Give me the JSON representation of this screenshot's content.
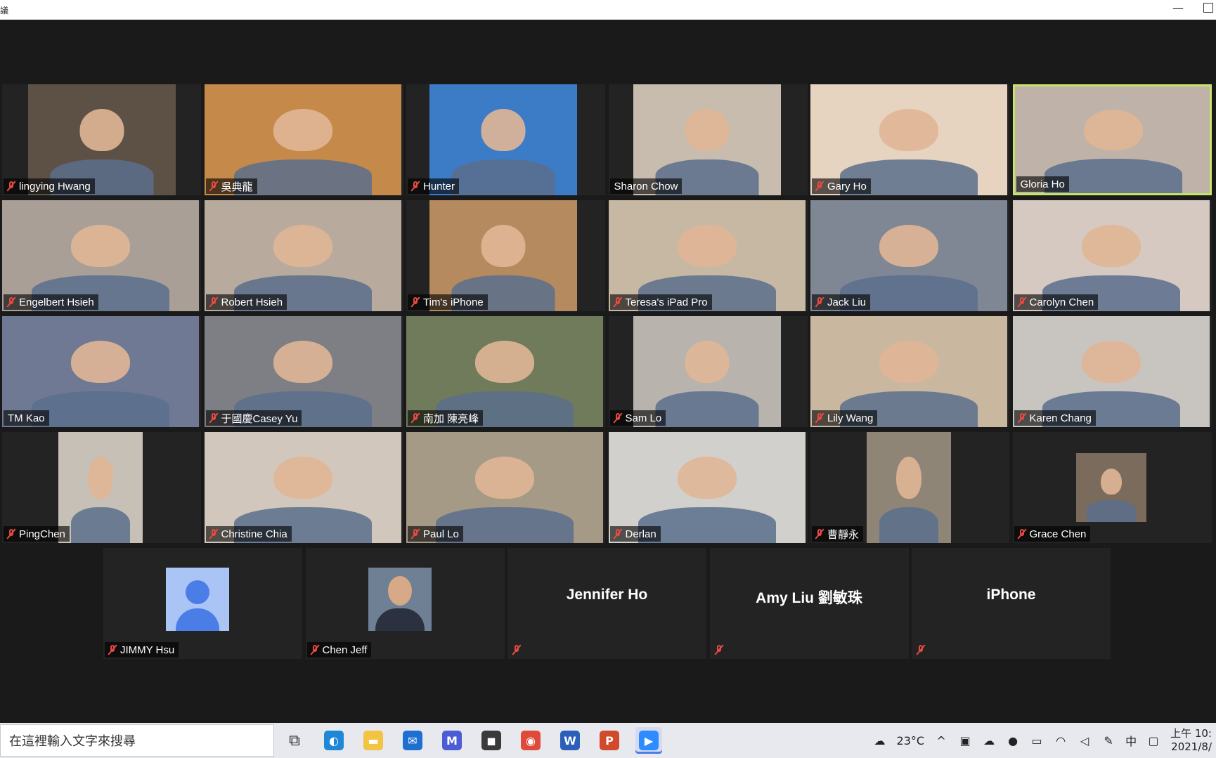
{
  "window": {
    "title_glyph": "議",
    "minimize": "—"
  },
  "tiles": [
    {
      "name": "lingying Hwang",
      "muted": true,
      "col": 0,
      "row": 0,
      "bg": "#5d5146",
      "vx": 37,
      "vw": 210
    },
    {
      "name": "吳典龍",
      "muted": true,
      "col": 1,
      "row": 0,
      "bg": "#c58a4a",
      "vx": 0,
      "vw": 280
    },
    {
      "name": "Hunter",
      "muted": true,
      "col": 2,
      "row": 0,
      "bg": "#3c7cc7",
      "vx": 33,
      "vw": 210
    },
    {
      "name": "Sharon Chow",
      "muted": false,
      "col": 3,
      "row": 0,
      "bg": "#c7bcae",
      "vx": 35,
      "vw": 210
    },
    {
      "name": "Gary Ho",
      "muted": true,
      "col": 4,
      "row": 0,
      "bg": "#e6d3c0",
      "vx": 0,
      "vw": 280
    },
    {
      "name": "Gloria Ho",
      "muted": false,
      "col": 5,
      "row": 0,
      "bg": "#bfb2a8",
      "vx": 0,
      "vw": 280,
      "active": true
    },
    {
      "name": "Engelbert Hsieh",
      "muted": true,
      "col": 0,
      "row": 1,
      "bg": "#a99f97",
      "vx": 0,
      "vw": 280
    },
    {
      "name": "Robert Hsieh",
      "muted": true,
      "col": 1,
      "row": 1,
      "bg": "#b8aa9d",
      "vx": 0,
      "vw": 280
    },
    {
      "name": "Tim's iPhone",
      "muted": true,
      "col": 2,
      "row": 1,
      "bg": "#b48a5e",
      "vx": 33,
      "vw": 210
    },
    {
      "name": "Teresa's iPad Pro",
      "muted": true,
      "col": 3,
      "row": 1,
      "bg": "#c7b8a4",
      "vx": 0,
      "vw": 280
    },
    {
      "name": "Jack Liu",
      "muted": true,
      "col": 4,
      "row": 1,
      "bg": "#7f8694",
      "vx": 0,
      "vw": 280
    },
    {
      "name": "Carolyn Chen",
      "muted": true,
      "col": 5,
      "row": 1,
      "bg": "#d6c9c2",
      "vx": 0,
      "vw": 280
    },
    {
      "name": "TM Kao",
      "muted": false,
      "col": 0,
      "row": 2,
      "bg": "#6f7994",
      "vx": 0,
      "vw": 280
    },
    {
      "name": "于國慶Casey Yu",
      "muted": true,
      "col": 1,
      "row": 2,
      "bg": "#7d7f84",
      "vx": 0,
      "vw": 280
    },
    {
      "name": "南加 陳亮峰",
      "muted": true,
      "col": 2,
      "row": 2,
      "bg": "#6f7b5a",
      "vx": 0,
      "vw": 280
    },
    {
      "name": "Sam Lo",
      "muted": true,
      "col": 3,
      "row": 2,
      "bg": "#b9b3ad",
      "vx": 35,
      "vw": 210
    },
    {
      "name": "Lily Wang",
      "muted": true,
      "col": 4,
      "row": 2,
      "bg": "#c9b89f",
      "vx": 0,
      "vw": 280
    },
    {
      "name": "Karen Chang",
      "muted": true,
      "col": 5,
      "row": 2,
      "bg": "#c8c4bf",
      "vx": 0,
      "vw": 280
    },
    {
      "name": "PingChen",
      "muted": true,
      "col": 0,
      "row": 3,
      "bg": "#c7c0b6",
      "vx": 80,
      "vw": 120
    },
    {
      "name": "Christine Chia",
      "muted": true,
      "col": 1,
      "row": 3,
      "bg": "#d2c7bd",
      "vx": 0,
      "vw": 280
    },
    {
      "name": "Paul Lo",
      "muted": true,
      "col": 2,
      "row": 3,
      "bg": "#a59a86",
      "vx": 0,
      "vw": 280
    },
    {
      "name": "Derlan",
      "muted": true,
      "col": 3,
      "row": 3,
      "bg": "#d2d0cc",
      "vx": 0,
      "vw": 280
    },
    {
      "name": "曹靜永",
      "muted": true,
      "col": 4,
      "row": 3,
      "bg": "#8f8577",
      "vx": 80,
      "vw": 120
    },
    {
      "name": "Grace Chen",
      "muted": true,
      "col": 5,
      "row": 3,
      "bg": "#7a6b5c",
      "vx": 90,
      "vw": 100,
      "small": true
    }
  ],
  "bottom_tiles": [
    {
      "name": "JIMMY Hsu",
      "muted": true,
      "type": "avatar"
    },
    {
      "name": "Chen Jeff",
      "muted": true,
      "type": "photo"
    },
    {
      "name": "Jennifer Ho",
      "muted": true,
      "type": "text"
    },
    {
      "name": "Amy Liu 劉敏珠",
      "muted": true,
      "type": "text"
    },
    {
      "name": "iPhone",
      "muted": true,
      "type": "text"
    }
  ],
  "taskbar": {
    "search_placeholder": "在這裡輸入文字來搜尋",
    "apps": [
      {
        "key": "taskview",
        "glyph": "⧉",
        "bg": "transparent"
      },
      {
        "key": "edge",
        "glyph": "◐",
        "bg": "#1e88d7"
      },
      {
        "key": "explorer",
        "glyph": "▬",
        "bg": "#f3c342"
      },
      {
        "key": "mail",
        "glyph": "✉",
        "bg": "#1f6fd0"
      },
      {
        "key": "app-m",
        "glyph": "M",
        "bg": "#4b5dd6"
      },
      {
        "key": "store",
        "glyph": "◼",
        "bg": "#3a3a3a"
      },
      {
        "key": "chrome",
        "glyph": "◉",
        "bg": "#e04a3a"
      },
      {
        "key": "word",
        "glyph": "W",
        "bg": "#2b5fb8"
      },
      {
        "key": "powerpoint",
        "glyph": "P",
        "bg": "#d04a2b"
      },
      {
        "key": "zoom",
        "glyph": "▶",
        "bg": "#2d8cff",
        "active": true
      }
    ],
    "weather": "23°C",
    "ime": "中",
    "clock_time": "上午 10:",
    "clock_date": "2021/8/"
  }
}
